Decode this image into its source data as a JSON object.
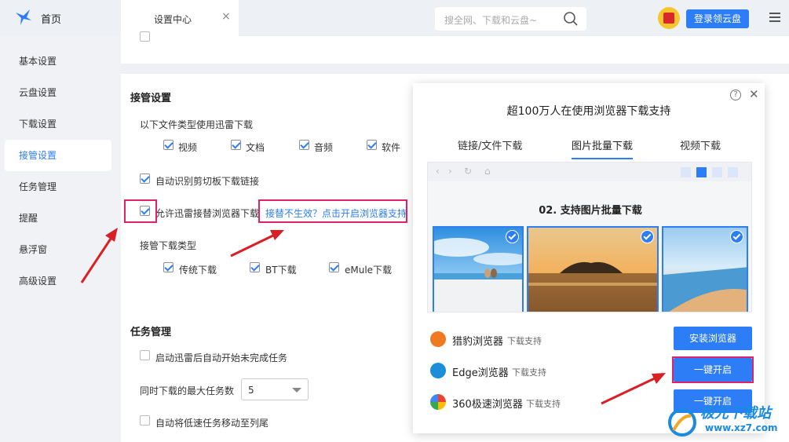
{
  "header": {
    "home_label": "首页",
    "tab_label": "设置中心",
    "search_placeholder": "搜全网、下载和云盘~",
    "login_button": "登录领云盘"
  },
  "sidebar": {
    "items": [
      {
        "label": "基本设置"
      },
      {
        "label": "云盘设置"
      },
      {
        "label": "下载设置"
      },
      {
        "label": "接管设置",
        "active": true
      },
      {
        "label": "任务管理"
      },
      {
        "label": "提醒"
      },
      {
        "label": "悬浮窗"
      },
      {
        "label": "高级设置"
      }
    ]
  },
  "takeover": {
    "title": "接管设置",
    "filetypes_label": "以下文件类型使用迅雷下载",
    "filetypes": [
      "视频",
      "文档",
      "音频",
      "软件"
    ],
    "clipboard_label": "自动识别剪切板下载链接",
    "browser_label": "允许迅雷接替浏览器下载",
    "fix_link": "接替不生效？点击开启浏览器支持",
    "download_types_label": "接管下载类型",
    "download_types": [
      "传统下载",
      "BT下载",
      "eMule下载"
    ]
  },
  "tasks": {
    "title": "任务管理",
    "auto_start_label": "启动迅雷后自动开始未完成任务",
    "max_tasks_label": "同时下载的最大任务数",
    "max_tasks_value": "5",
    "move_slow_label": "自动将低速任务移动至列尾"
  },
  "popup": {
    "title": "超100万人在使用浏览器下载支持",
    "tabs": [
      "链接/文件下载",
      "图片批量下载",
      "视频下载"
    ],
    "active_tab": "图片批量下载",
    "preview_title": "02. 支持图片批量下载",
    "browsers": [
      {
        "name": "猎豹浏览器",
        "sub": "下载支持",
        "button": "安装浏览器",
        "logo_color": "#f07a22"
      },
      {
        "name": "Edge浏览器",
        "sub": "下载支持",
        "button": "一键开启",
        "logo_color": "#1c8fd8"
      },
      {
        "name": "360极速浏览器",
        "sub": "下载支持",
        "button": "一键开启",
        "logo_color": "#36b24a"
      }
    ]
  },
  "watermark": {
    "text1": "极光下载站",
    "text2": "www.xz7.com"
  },
  "colors": {
    "accent": "#2d7df6",
    "highlight": "#e0226b",
    "arrow": "#d81f26"
  }
}
